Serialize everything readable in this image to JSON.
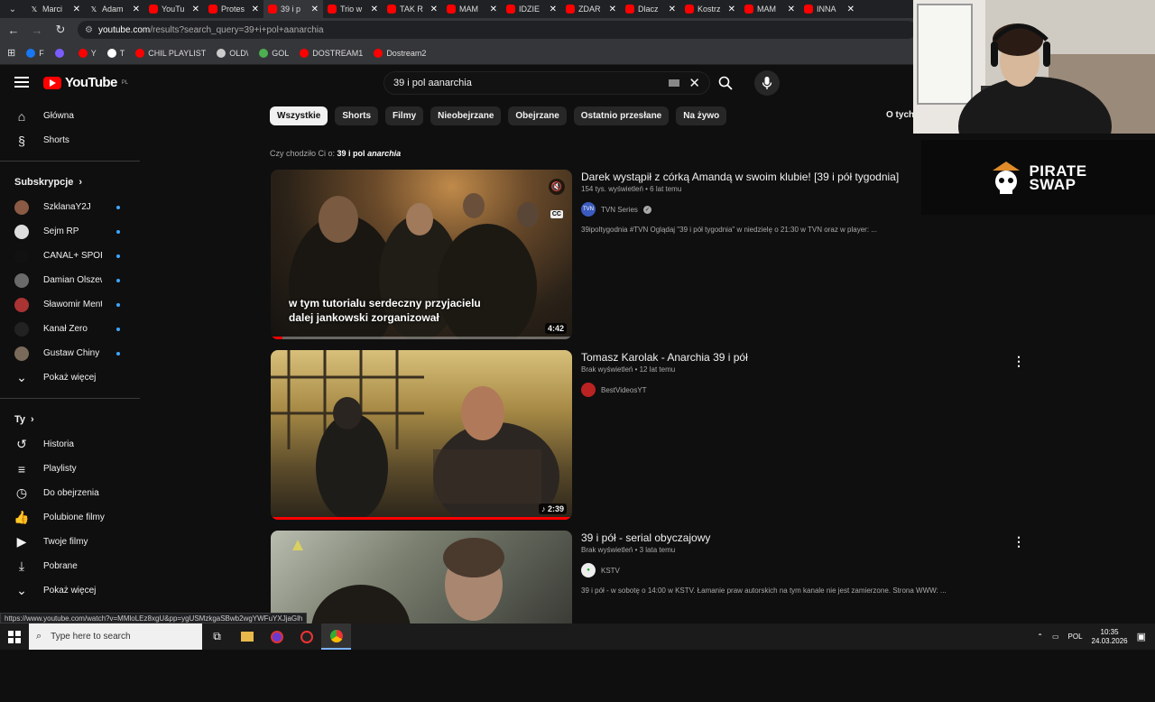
{
  "browser": {
    "tabs": [
      {
        "title": "Marci",
        "icon": "x-icon",
        "active": false
      },
      {
        "title": "Adam",
        "icon": "x-icon",
        "active": false
      },
      {
        "title": "YouTu",
        "icon": "youtube-icon",
        "active": false
      },
      {
        "title": "Protes",
        "icon": "youtube-icon",
        "active": false
      },
      {
        "title": "39 i p",
        "icon": "youtube-icon",
        "active": true
      },
      {
        "title": "Trio w",
        "icon": "youtube-icon",
        "active": false
      },
      {
        "title": "TAK R",
        "icon": "youtube-icon",
        "active": false
      },
      {
        "title": "MAM",
        "icon": "youtube-icon",
        "active": false
      },
      {
        "title": "IDZIE",
        "icon": "youtube-icon",
        "active": false
      },
      {
        "title": "ZDAR",
        "icon": "youtube-icon",
        "active": false
      },
      {
        "title": "Dlacz",
        "icon": "youtube-icon",
        "active": false
      },
      {
        "title": "Kostrz",
        "icon": "youtube-icon",
        "active": false
      },
      {
        "title": "MAM",
        "icon": "youtube-icon",
        "active": false
      },
      {
        "title": "INNA",
        "icon": "youtube-icon",
        "active": false
      }
    ],
    "url_host": "youtube.com",
    "url_path": "/results?search_query=39+i+pol+aanarchia",
    "bookmarks": [
      {
        "label": "F",
        "color": "#1877f2"
      },
      {
        "label": "",
        "color": "#7b5cff"
      },
      {
        "label": "Y",
        "color": "#f00"
      },
      {
        "label": "T",
        "color": "#fff"
      },
      {
        "label": "CHIL PLAYLIST",
        "color": "#f00"
      },
      {
        "label": "OLD\\",
        "color": "#ccc"
      },
      {
        "label": "GOL",
        "color": "#4caf50"
      },
      {
        "label": "DOSTREAM1",
        "color": "#f00"
      },
      {
        "label": "Dostream2",
        "color": "#f00"
      }
    ],
    "status_url": "https://www.youtube.com/watch?v=MMloLEz8xgU&pp=ygUSMzkgaSBwb2wgYWFuYXJjaGlh"
  },
  "youtube": {
    "logo_text": "YouTube",
    "region": "PL",
    "search_query": "39 i pol aanarchia"
  },
  "sidebar": {
    "main": [
      {
        "label": "Główna",
        "icon": "home-icon"
      },
      {
        "label": "Shorts",
        "icon": "shorts-icon"
      }
    ],
    "subs_header": "Subskrypcje",
    "subscriptions": [
      {
        "name": "SzklanaY2J",
        "color": "#8a5a44"
      },
      {
        "name": "Sejm RP",
        "color": "#ddd"
      },
      {
        "name": "CANAL+ SPORT",
        "color": "#111"
      },
      {
        "name": "Damian Olszews...",
        "color": "#6a6a6a"
      },
      {
        "name": "Sławomir Mentz...",
        "color": "#a33"
      },
      {
        "name": "Kanał Zero",
        "color": "#222"
      },
      {
        "name": "Gustaw Chiny",
        "color": "#7a6a5a"
      }
    ],
    "subs_more": "Pokaż więcej",
    "you_header": "Ty",
    "you_items": [
      {
        "label": "Historia",
        "icon": "history-icon"
      },
      {
        "label": "Playlisty",
        "icon": "playlist-icon"
      },
      {
        "label": "Do obejrzenia",
        "icon": "clock-icon"
      },
      {
        "label": "Polubione filmy",
        "icon": "thumbs-up-icon"
      },
      {
        "label": "Twoje filmy",
        "icon": "video-icon"
      },
      {
        "label": "Pobrane",
        "icon": "download-icon"
      },
      {
        "label": "Pokaż więcej",
        "icon": "chevron-down-icon"
      }
    ]
  },
  "chips": [
    "Wszystkie",
    "Shorts",
    "Filmy",
    "Nieobejrzane",
    "Obejrzane",
    "Ostatnio przesłane",
    "Na żywo"
  ],
  "filters_label": "O tych",
  "did_you_mean": {
    "prefix": "Czy chodziło Ci o:",
    "normal": "39 i pol",
    "italic": "anarchia"
  },
  "videos": [
    {
      "title": "Darek wystąpił z córką Amandą w swoim klubie! [39 i pół tygodnia]",
      "meta": "154 tys. wyświetleń • 6 lat temu",
      "channel": "TVN Series",
      "channel_badge": "TVN",
      "verified": true,
      "description": "39ipoltygodnia #TVN Oglądaj \"39 i pół tygodnia\" w niedzielę o 21:30 w TVN oraz w player: ...",
      "duration": "4:42",
      "caption": "w tym tutorialu serdeczny przyjacielu dalej jankowski zorganizował",
      "progress": 0.04
    },
    {
      "title": "Tomasz Karolak - Anarchia 39 i pół",
      "meta": "Brak wyświetleń • 12 lat temu",
      "channel": "BestVideosYT",
      "channel_badge": "",
      "verified": false,
      "description": "",
      "duration": "2:39",
      "caption": "",
      "progress": 1.0
    },
    {
      "title": "39 i pół - serial obyczajowy",
      "meta": "Brak wyświetleń • 3 lata temu",
      "channel": "KSTV",
      "channel_badge": "",
      "verified": false,
      "description": "39 i pół - w sobotę o 14:00 w KSTV. Łamanie praw autorskich na tym kanale nie jest zamierzone. Strona WWW: ...",
      "duration": "",
      "caption": "",
      "progress": 0
    }
  ],
  "overlay": {
    "sponsor_line1": "PIRATE",
    "sponsor_line2": "SWAP"
  },
  "taskbar": {
    "search_placeholder": "Type here to search",
    "language": "POL",
    "time": "10:35",
    "date": "24.03.2026"
  }
}
